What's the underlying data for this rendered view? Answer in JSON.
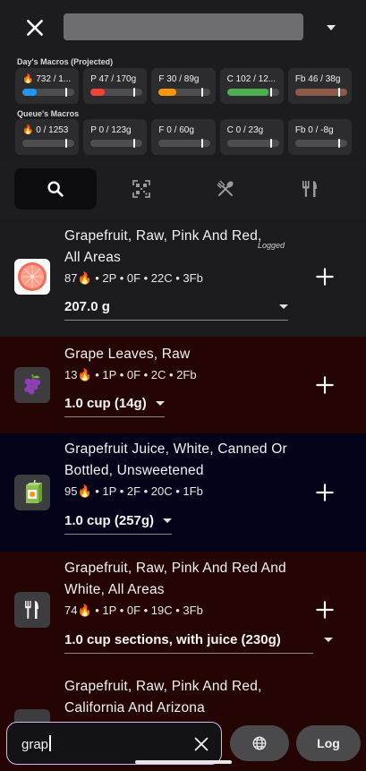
{
  "header": {
    "close_icon": "close-icon",
    "title_value": "",
    "dropdown_icon": "caret-down-icon"
  },
  "day_macros": {
    "label": "Day's Macros (Projected)",
    "cards": [
      {
        "text": "🔥 732 / 1...",
        "fill_fraction": 0.28,
        "color": "#2196f3"
      },
      {
        "text": "P 47 / 170g",
        "fill_fraction": 0.28,
        "color": "#f44336"
      },
      {
        "text": "F 30 / 89g",
        "fill_fraction": 0.34,
        "color": "#ff9800"
      },
      {
        "text": "C 102 / 12...",
        "fill_fraction": 0.8,
        "color": "#4caf50"
      },
      {
        "text": "Fb 46 / 38g",
        "fill_fraction": 1.0,
        "color": "#8d5a45"
      }
    ]
  },
  "queue_macros": {
    "label": "Queue's Macros",
    "cards": [
      {
        "text": "🔥 0 / 1253",
        "fill_fraction": 0
      },
      {
        "text": "P 0 / 123g",
        "fill_fraction": 0
      },
      {
        "text": "F 0 / 60g",
        "fill_fraction": 0
      },
      {
        "text": "C 0 / 23g",
        "fill_fraction": 0
      },
      {
        "text": "Fb 0 / -8g",
        "fill_fraction": 0
      }
    ]
  },
  "tabs": [
    {
      "icon": "search-icon",
      "active": true
    },
    {
      "icon": "barcode-scan-icon",
      "active": false
    },
    {
      "icon": "utensils-crossed-icon",
      "active": false
    },
    {
      "icon": "restaurant-icon",
      "active": false
    }
  ],
  "foods": [
    {
      "name": "Grapefruit, Raw, Pink And Red, All Areas",
      "macros": "87🔥 • 2P • 0F • 22C • 3Fb",
      "serving": "207.0 g",
      "logged": "Logged",
      "icon": "grapefruit-icon",
      "bg": "#1b1b1d"
    },
    {
      "name": "Grape Leaves, Raw",
      "macros": "13🔥 • 1P • 0F • 2C • 2Fb",
      "serving": "1.0 cup (14g)",
      "icon": "grapes-icon",
      "bg": "#250503"
    },
    {
      "name": "Grapefruit Juice, White, Canned Or Bottled, Unsweetened",
      "macros": "95🔥 • 1P • 2F • 20C • 1Fb",
      "serving": "1.0 cup (257g)",
      "icon": "juice-box-icon",
      "bg": "#03041a"
    },
    {
      "name": "Grapefruit, Raw, Pink And Red And White, All Areas",
      "macros": "74🔥 • 1P • 0F • 19C • 3Fb",
      "serving": "1.0 cup sections, with juice (230g)",
      "icon": "fork-knife-icon",
      "bg": "#250503"
    },
    {
      "name": "Grapefruit, Raw, Pink And Red, California And Arizona",
      "icon": "food-icon",
      "bg": "#250503"
    }
  ],
  "search": {
    "value": "grap",
    "clear_icon": "close-icon"
  },
  "buttons": {
    "globe_icon": "globe-icon",
    "log_label": "Log"
  }
}
